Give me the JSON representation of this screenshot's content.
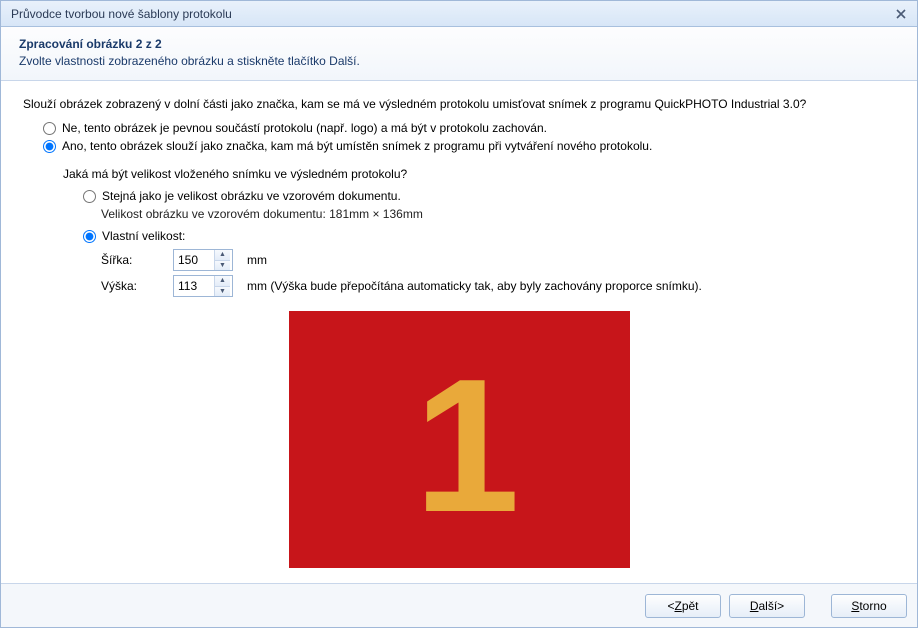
{
  "window": {
    "title": "Průvodce tvorbou nové šablony protokolu"
  },
  "header": {
    "title": "Zpracování obrázku 2 z 2",
    "subtitle": "Zvolte vlastnosti zobrazeného obrázku a stiskněte tlačítko Další."
  },
  "main": {
    "question": "Slouží obrázek zobrazený v dolní části jako značka, kam se má ve výsledném protokolu umisťovat snímek z programu QuickPHOTO Industrial 3.0?",
    "opt_no": "Ne, tento obrázek je pevnou součástí protokolu (např. logo) a má být v protokolu zachován.",
    "opt_yes": "Ano, tento obrázek slouží jako značka, kam má být umístěn snímek z programu při vytváření nového protokolu.",
    "selected_main": "yes",
    "size_question": "Jaká má být velikost vloženého snímku ve výsledném protokolu?",
    "size_same": "Stejná jako je velikost obrázku ve vzorovém dokumentu.",
    "size_note": "Velikost obrázku ve vzorovém dokumentu: 181mm × 136mm",
    "size_custom": "Vlastní velikost:",
    "selected_size": "custom",
    "width_label": "Šířka:",
    "height_label": "Výška:",
    "width_value": "150",
    "height_value": "113",
    "unit": "mm",
    "height_note": "mm (Výška bude přepočítána automaticky tak, aby byly zachovány proporce snímku).",
    "preview_digit": "1",
    "preview_bg": "#c7151a",
    "preview_fg": "#e9a93a"
  },
  "footer": {
    "back": "Zpět",
    "next": "Další",
    "cancel": "Storno",
    "back_arrow": "< ",
    "next_arrow": " >"
  }
}
